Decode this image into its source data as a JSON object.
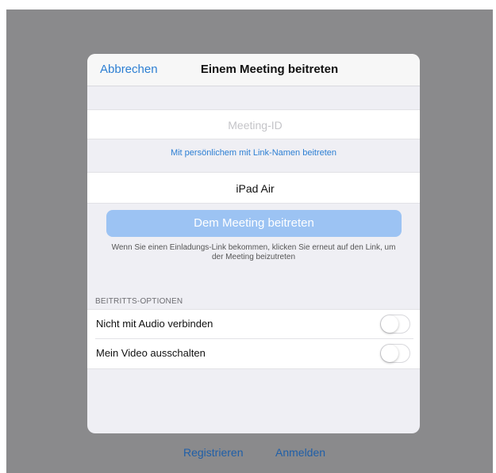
{
  "header": {
    "cancel_label": "Abbrechen",
    "title": "Einem Meeting beitreten"
  },
  "form": {
    "meeting_id_placeholder": "Meeting-ID",
    "meeting_id_value": "",
    "link_name_text": "Mit persönlichem mit Link-Namen beitreten",
    "device_name": "iPad Air",
    "join_button_label": "Dem Meeting beitreten",
    "hint_text": "Wenn Sie einen Einladungs-Link bekommen, klicken Sie erneut auf den Link, um der Meeting beizutreten"
  },
  "options": {
    "section_header": "BEITRITTS-OPTIONEN",
    "items": [
      {
        "label": "Nicht mit Audio verbinden",
        "enabled": false
      },
      {
        "label": "Mein Video ausschalten",
        "enabled": false
      }
    ]
  },
  "footer": {
    "register_label": "Registrieren",
    "login_label": "Anmelden"
  },
  "colors": {
    "accent": "#2d7fd3",
    "join_button_disabled": "#9cc3f3",
    "overlay": "#8a8a8c"
  }
}
